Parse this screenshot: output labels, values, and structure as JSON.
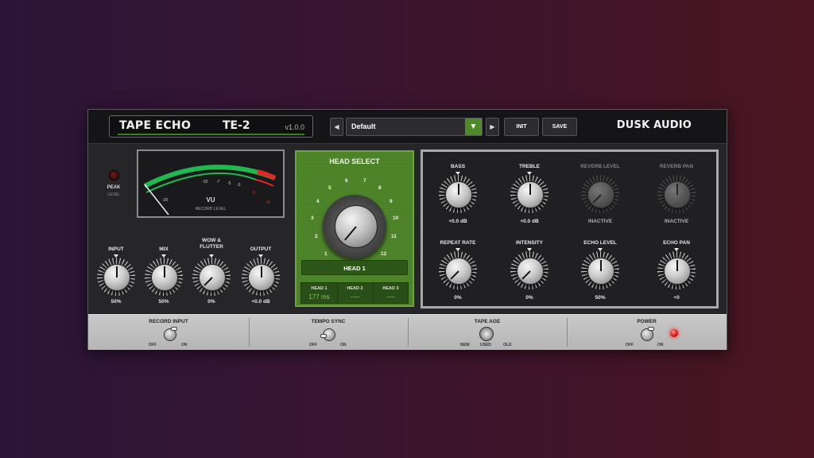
{
  "header": {
    "plugin_name": "TAPE ECHO",
    "model": "TE-2",
    "version": "v1.0.0",
    "prev_preset": "◀",
    "next_preset": "▶",
    "preset_name": "Default",
    "preset_dropdown": "▼",
    "init_label": "INIT",
    "save_label": "SAVE",
    "brand": "DUSK AUDIO"
  },
  "peak": {
    "label": "PEAK",
    "sublabel": "LEVEL"
  },
  "meter": {
    "label": "VU",
    "sublabel": "RECORD LEVEL",
    "ticks": [
      "-20",
      "-10",
      "-7",
      "-5",
      "-3",
      "0",
      "+3"
    ]
  },
  "left_knobs": {
    "input": {
      "label": "INPUT",
      "value": "50%",
      "level": 0.5
    },
    "mix": {
      "label": "MIX",
      "value": "50%",
      "level": 0.5
    },
    "wow": {
      "label": "WOW &\nFLUTTER",
      "value": "0%",
      "level": 0.0
    },
    "output": {
      "label": "OUTPUT",
      "value": "+0.0 dB",
      "level": 0.5
    }
  },
  "head_select": {
    "title": "HEAD SELECT",
    "positions": [
      "1",
      "2",
      "3",
      "4",
      "5",
      "6",
      "7",
      "8",
      "9",
      "10",
      "11",
      "12"
    ],
    "selected": "HEAD 1",
    "heads": [
      {
        "name": "HEAD 1",
        "value": "177 ms"
      },
      {
        "name": "HEAD 2",
        "value": "-----"
      },
      {
        "name": "HEAD 3",
        "value": "-----"
      }
    ]
  },
  "right_knobs": {
    "bass": {
      "label": "BASS",
      "value": "+0.0 dB",
      "level": 0.5
    },
    "treble": {
      "label": "TREBLE",
      "value": "+0.0 dB",
      "level": 0.5
    },
    "reverb_level": {
      "label": "REVERB LEVEL",
      "value": "INACTIVE",
      "level": 0.0
    },
    "reverb_pan": {
      "label": "REVERB PAN",
      "value": "INACTIVE",
      "level": 0.5
    },
    "repeat_rate": {
      "label": "REPEAT RATE",
      "value": "0%",
      "level": 0.0
    },
    "intensity": {
      "label": "INTENSITY",
      "value": "0%",
      "level": 0.0
    },
    "echo_level": {
      "label": "ECHO LEVEL",
      "value": "50%",
      "level": 0.5
    },
    "echo_pan": {
      "label": "ECHO PAN",
      "value": "+0",
      "level": 0.5
    }
  },
  "bottom": {
    "record_input": {
      "label": "RECORD INPUT",
      "off": "OFF",
      "on": "ON"
    },
    "tempo_sync": {
      "label": "TEMPO SYNC",
      "off": "OFF",
      "on": "ON"
    },
    "tape_age": {
      "label": "TAPE AGE",
      "new": "NEW",
      "used": "USED",
      "old": "OLD"
    },
    "power": {
      "label": "POWER",
      "off": "OFF",
      "on": "ON"
    }
  },
  "colors": {
    "accent_green": "#4b8127",
    "led_red": "#e41111",
    "meter_green": "#21b84f",
    "meter_red": "#e02828"
  }
}
